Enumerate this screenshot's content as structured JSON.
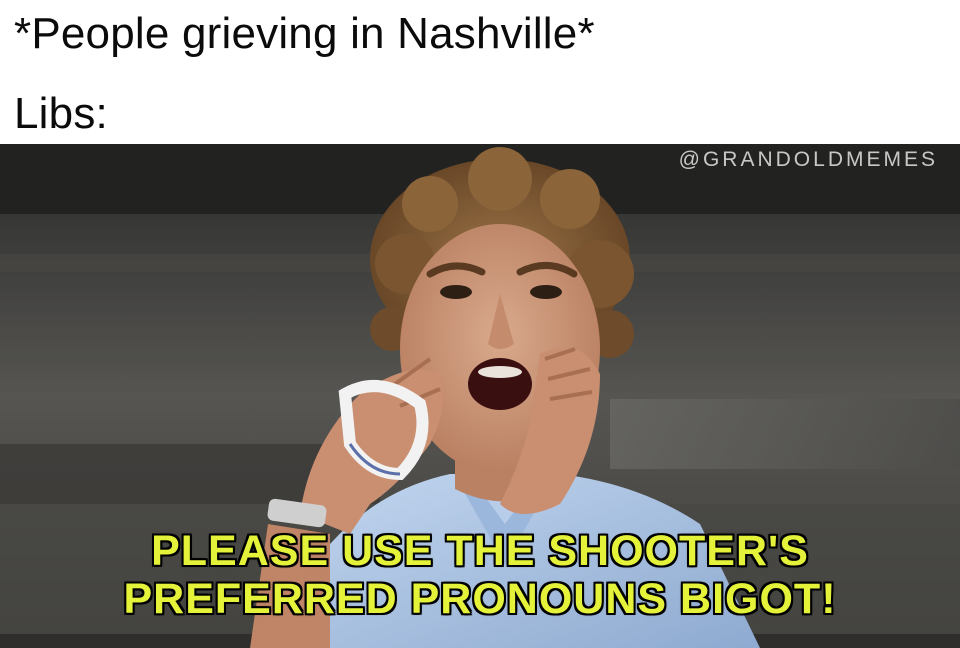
{
  "caption": {
    "line1": "*People grieving in Nashville*",
    "line2": "Libs:"
  },
  "watermark": "@GRANDOLDMEMES",
  "image_text": {
    "line1": "PLEASE USE THE SHOOTER'S",
    "line2": "PREFERRED PRONOUNS BIGOT!"
  },
  "colors": {
    "caption_text": "#0b0b0b",
    "impact_fill": "#e4f23a",
    "impact_outline": "#000000",
    "shirt": "#a9c4e6",
    "hair": "#8a6238"
  }
}
